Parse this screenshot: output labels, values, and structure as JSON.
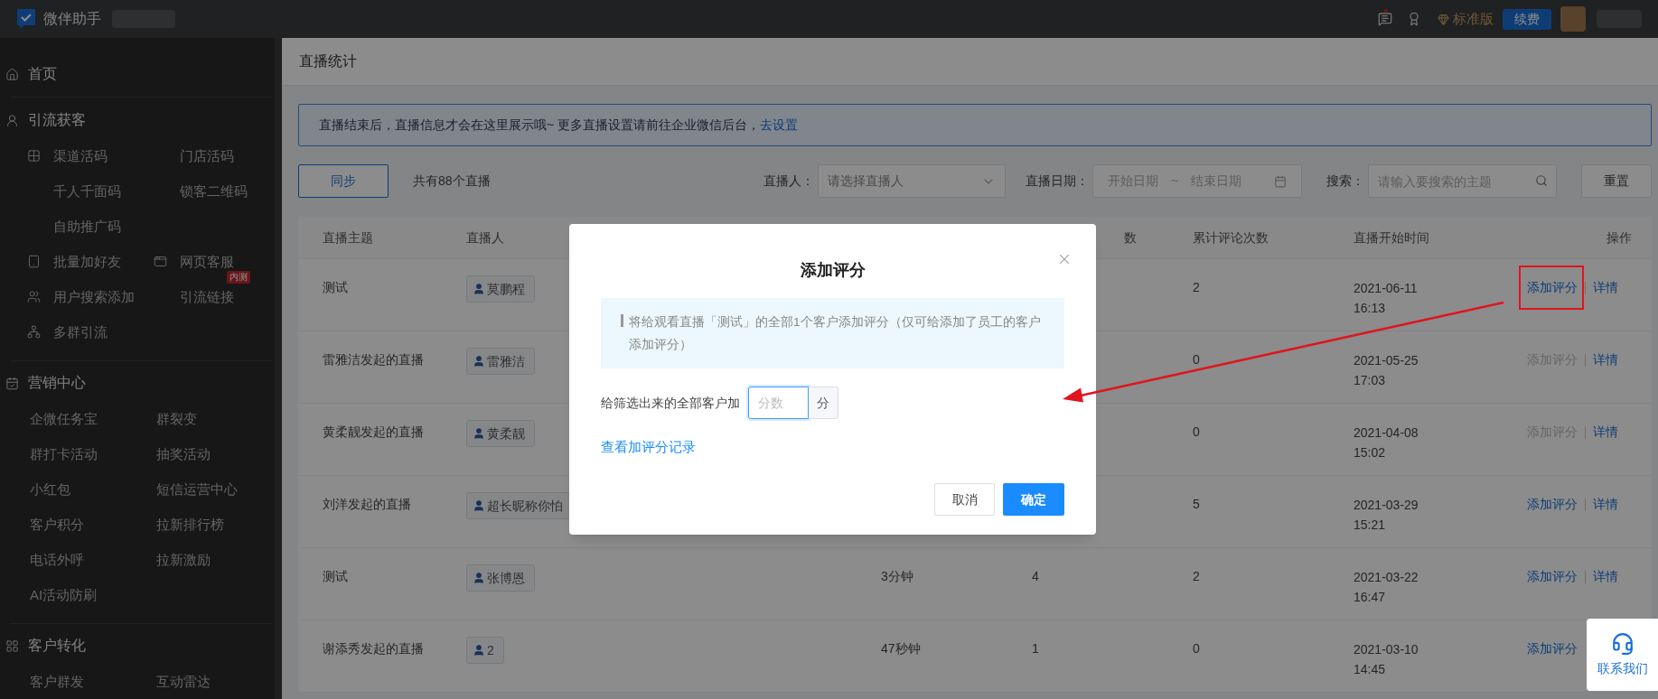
{
  "topbar": {
    "app_name": "微伴助手",
    "edition": "标准版",
    "renew_button": "续费"
  },
  "sidebar": {
    "sections": [
      {
        "title": "首页"
      },
      {
        "title": "引流获客",
        "rows": [
          [
            {
              "label": "渠道活码"
            },
            {
              "label": "门店活码"
            }
          ],
          [
            {
              "label": "千人千面码"
            },
            {
              "label": "锁客二维码"
            }
          ],
          [
            {
              "label": "自助推广码"
            }
          ],
          [
            {
              "label": "批量加好友"
            },
            {
              "label": "网页客服"
            }
          ],
          [
            {
              "label": "用户搜索添加"
            },
            {
              "label": "引流链接",
              "badge": "内测"
            }
          ],
          [
            {
              "label": "多群引流"
            }
          ]
        ]
      },
      {
        "title": "营销中心",
        "rows": [
          [
            {
              "label": "企微任务宝"
            },
            {
              "label": "群裂变"
            }
          ],
          [
            {
              "label": "群打卡活动"
            },
            {
              "label": "抽奖活动"
            }
          ],
          [
            {
              "label": "小红包"
            },
            {
              "label": "短信运营中心"
            }
          ],
          [
            {
              "label": "客户积分"
            },
            {
              "label": "拉新排行榜"
            }
          ],
          [
            {
              "label": "电话外呼"
            },
            {
              "label": "拉新激励"
            }
          ],
          [
            {
              "label": "AI活动防刷"
            }
          ]
        ]
      },
      {
        "title": "客户转化",
        "rows": [
          [
            {
              "label": "客户群发"
            },
            {
              "label": "互动雷达"
            }
          ]
        ]
      }
    ]
  },
  "page_title": "直播统计",
  "notice": {
    "text": "直播结束后，直播信息才会在这里展示哦~ 更多直播设置请前往企业微信后台，",
    "link": "去设置"
  },
  "toolbar": {
    "sync_button": "同步",
    "total": "共有88个直播",
    "reset_button": "重置"
  },
  "streamer_filter": {
    "label": "直播人：",
    "placeholder": "请选择直播人"
  },
  "date_filter": {
    "label": "直播日期：",
    "start_placeholder": "开始日期",
    "separator": "~",
    "end_placeholder": "结束日期"
  },
  "search": {
    "label": "搜索：",
    "placeholder": "请输入要搜索的主题"
  },
  "table": {
    "columns": {
      "column_1": "直播主题",
      "column_2": "直播人",
      "column_4": "数",
      "column_5": "累计评论次数",
      "column_6": "直播开始时间",
      "column_7": "操作"
    },
    "rows": [
      {
        "topic": "测试",
        "streamer": "莫鹏程",
        "comments": "2",
        "date": "2021-06-11",
        "time": "16:13",
        "actions": [
          {
            "label": "添加评分",
            "disabled": false,
            "highlighted": true
          },
          {
            "label": "详情",
            "disabled": false,
            "highlighted": false
          }
        ]
      },
      {
        "topic": "雷雅洁发起的直播",
        "streamer": "雷雅洁",
        "comments": "0",
        "date": "2021-05-25",
        "time": "17:03",
        "actions": [
          {
            "label": "添加评分",
            "disabled": true,
            "highlighted": false
          },
          {
            "label": "详情",
            "disabled": false,
            "highlighted": false
          }
        ]
      },
      {
        "topic": "黄柔靓发起的直播",
        "streamer": "黄柔靓",
        "comments": "0",
        "date": "2021-04-08",
        "time": "15:02",
        "actions": [
          {
            "label": "添加评分",
            "disabled": true,
            "highlighted": false
          },
          {
            "label": "详情",
            "disabled": false,
            "highlighted": false
          }
        ]
      },
      {
        "topic": "刘洋发起的直播",
        "streamer": "超长昵称你怕",
        "comments": "5",
        "date": "2021-03-29",
        "time": "15:21",
        "actions": [
          {
            "label": "添加评分",
            "disabled": false,
            "highlighted": false
          },
          {
            "label": "详情",
            "disabled": false,
            "highlighted": false
          }
        ]
      },
      {
        "topic": "测试",
        "streamer": "张博恩",
        "column_3": "3分钟",
        "column_4": "4",
        "comments": "2",
        "date": "2021-03-22",
        "time": "16:47",
        "actions": [
          {
            "label": "添加评分",
            "disabled": false,
            "highlighted": false
          },
          {
            "label": "详情",
            "disabled": false,
            "highlighted": false
          }
        ]
      },
      {
        "topic": "谢添秀发起的直播",
        "streamer": "2",
        "column_3": "47秒钟",
        "column_4": "1",
        "comments": "0",
        "date": "2021-03-10",
        "time": "14:45",
        "actions": [
          {
            "label": "添加评分",
            "disabled": false,
            "highlighted": false
          }
        ]
      }
    ]
  },
  "modal": {
    "title": "添加评分",
    "info": "将给观看直播「测试」的全部1个客户添加评分（仅可给添加了员工的客户添加评分）",
    "field_label": "给筛选出来的全部客户加",
    "field_placeholder": "分数",
    "unit": "分",
    "records_link": "查看加评分记录",
    "cancel_button": "取消",
    "confirm_button": "确定"
  },
  "contact": {
    "label": "联系我们"
  }
}
